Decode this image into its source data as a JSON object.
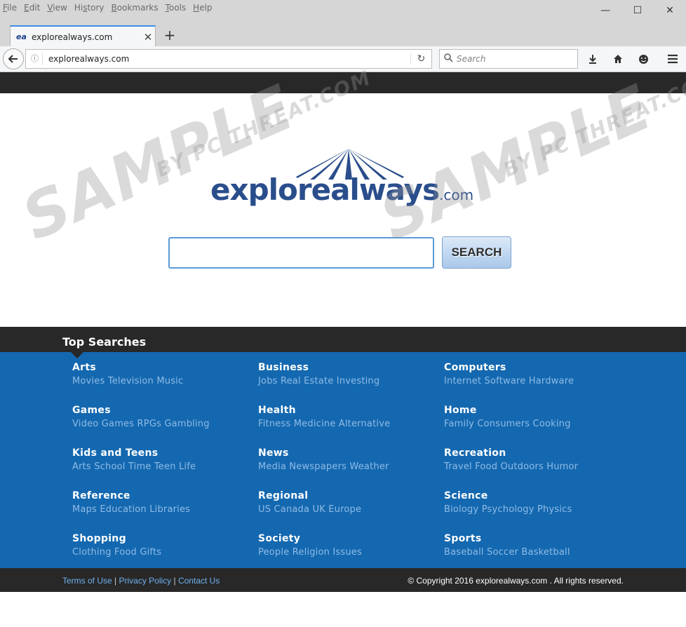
{
  "browser": {
    "menu": [
      "File",
      "Edit",
      "View",
      "History",
      "Bookmarks",
      "Tools",
      "Help"
    ],
    "menu_accel_index": [
      0,
      0,
      0,
      2,
      0,
      0,
      0
    ],
    "window_controls": {
      "minimize": "—",
      "maximize": "☐",
      "close": "✕"
    },
    "tab": {
      "favicon": "ea",
      "title": "explorealways.com",
      "close": "✕"
    },
    "newtab": "+",
    "url": "explorealways.com",
    "search_placeholder": "Search",
    "icons": [
      "back-arrow-icon",
      "info-icon",
      "reload-icon",
      "search-icon",
      "download-icon",
      "home-icon",
      "smiley-icon",
      "hamburger-menu-icon"
    ]
  },
  "page": {
    "logo": {
      "name": "explorealways",
      "tld": ".com"
    },
    "search": {
      "button_label": "SEARCH",
      "value": ""
    },
    "top_searches": {
      "title": "Top Searches",
      "categories": [
        {
          "name": "Arts",
          "sub": "Movies Television Music"
        },
        {
          "name": "Business",
          "sub": "Jobs Real Estate Investing"
        },
        {
          "name": "Computers",
          "sub": "Internet Software Hardware"
        },
        {
          "name": "Games",
          "sub": "Video Games RPGs Gambling"
        },
        {
          "name": "Health",
          "sub": "Fitness Medicine Alternative"
        },
        {
          "name": "Home",
          "sub": "Family Consumers Cooking"
        },
        {
          "name": "Kids and Teens",
          "sub": "Arts School Time Teen Life"
        },
        {
          "name": "News",
          "sub": "Media Newspapers Weather"
        },
        {
          "name": "Recreation",
          "sub": "Travel Food Outdoors Humor"
        },
        {
          "name": "Reference",
          "sub": "Maps Education Libraries"
        },
        {
          "name": "Regional",
          "sub": "US Canada UK Europe"
        },
        {
          "name": "Science",
          "sub": "Biology Psychology Physics"
        },
        {
          "name": "Shopping",
          "sub": "Clothing Food Gifts"
        },
        {
          "name": "Society",
          "sub": "People Religion Issues"
        },
        {
          "name": "Sports",
          "sub": "Baseball Soccer Basketball"
        }
      ]
    },
    "footer": {
      "links": [
        "Terms of Use",
        "Privacy Policy",
        "Contact Us"
      ],
      "separator": " | ",
      "copyright": "© Copyright 2016 explorealways.com . All rights reserved."
    }
  },
  "watermark": {
    "main": "SAMPLE",
    "sub": "BY PC THREAT.COM"
  },
  "colors": {
    "accent": "#1468b0",
    "dark_bar": "#282828",
    "logo": "#2a4e8c",
    "sub_link": "#8fbbe6"
  }
}
